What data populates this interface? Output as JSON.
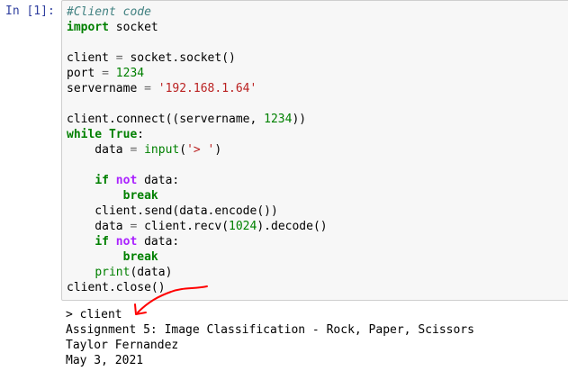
{
  "cell": {
    "prompt": "In [1]:",
    "code": [
      {
        "segments": [
          {
            "t": "#Client code",
            "c": "cm"
          }
        ]
      },
      {
        "segments": [
          {
            "t": "import",
            "c": "kw"
          },
          {
            "t": " socket",
            "c": ""
          }
        ]
      },
      {
        "segments": [
          {
            "t": "",
            "c": ""
          }
        ]
      },
      {
        "segments": [
          {
            "t": "client ",
            "c": ""
          },
          {
            "t": "=",
            "c": "op"
          },
          {
            "t": " socket.socket()",
            "c": ""
          }
        ]
      },
      {
        "segments": [
          {
            "t": "port ",
            "c": ""
          },
          {
            "t": "=",
            "c": "op"
          },
          {
            "t": " ",
            "c": ""
          },
          {
            "t": "1234",
            "c": "num"
          }
        ]
      },
      {
        "segments": [
          {
            "t": "servername ",
            "c": ""
          },
          {
            "t": "=",
            "c": "op"
          },
          {
            "t": " ",
            "c": ""
          },
          {
            "t": "'192.168.1.64'",
            "c": "str"
          }
        ]
      },
      {
        "segments": [
          {
            "t": "",
            "c": ""
          }
        ]
      },
      {
        "segments": [
          {
            "t": "client.connect((servername, ",
            "c": ""
          },
          {
            "t": "1234",
            "c": "num"
          },
          {
            "t": "))",
            "c": ""
          }
        ]
      },
      {
        "segments": [
          {
            "t": "while",
            "c": "kw"
          },
          {
            "t": " ",
            "c": ""
          },
          {
            "t": "True",
            "c": "kw"
          },
          {
            "t": ":",
            "c": ""
          }
        ]
      },
      {
        "segments": [
          {
            "t": "    data ",
            "c": ""
          },
          {
            "t": "=",
            "c": "op"
          },
          {
            "t": " ",
            "c": ""
          },
          {
            "t": "input",
            "c": "fn"
          },
          {
            "t": "(",
            "c": ""
          },
          {
            "t": "'> '",
            "c": "str"
          },
          {
            "t": ")",
            "c": ""
          }
        ]
      },
      {
        "segments": [
          {
            "t": "",
            "c": ""
          }
        ]
      },
      {
        "segments": [
          {
            "t": "    ",
            "c": ""
          },
          {
            "t": "if",
            "c": "kw"
          },
          {
            "t": " ",
            "c": ""
          },
          {
            "t": "not",
            "c": "kw-op"
          },
          {
            "t": " data:",
            "c": ""
          }
        ]
      },
      {
        "segments": [
          {
            "t": "        ",
            "c": ""
          },
          {
            "t": "break",
            "c": "kw"
          }
        ]
      },
      {
        "segments": [
          {
            "t": "    client.send(data.encode())",
            "c": ""
          }
        ]
      },
      {
        "segments": [
          {
            "t": "    data ",
            "c": ""
          },
          {
            "t": "=",
            "c": "op"
          },
          {
            "t": " client.recv(",
            "c": ""
          },
          {
            "t": "1024",
            "c": "num"
          },
          {
            "t": ").decode()",
            "c": ""
          }
        ]
      },
      {
        "segments": [
          {
            "t": "    ",
            "c": ""
          },
          {
            "t": "if",
            "c": "kw"
          },
          {
            "t": " ",
            "c": ""
          },
          {
            "t": "not",
            "c": "kw-op"
          },
          {
            "t": " data:",
            "c": ""
          }
        ]
      },
      {
        "segments": [
          {
            "t": "        ",
            "c": ""
          },
          {
            "t": "break",
            "c": "kw"
          }
        ]
      },
      {
        "segments": [
          {
            "t": "    ",
            "c": ""
          },
          {
            "t": "print",
            "c": "fn"
          },
          {
            "t": "(data)",
            "c": ""
          }
        ]
      },
      {
        "segments": [
          {
            "t": "client.close()",
            "c": ""
          }
        ]
      }
    ],
    "output": [
      "> client",
      "Assignment 5: Image Classification - Rock, Paper, Scissors",
      "Taylor Fernandez",
      "May 3, 2021"
    ]
  },
  "colors": {
    "prompt": "#303f9f",
    "cell_background": "#f7f7f7",
    "cell_border": "#cfcfcf",
    "keyword": "#008000",
    "comment": "#408080",
    "string": "#ba2121",
    "operator": "#666666",
    "annotation_arrow": "#ff0000"
  },
  "icons": {
    "annotation": "red-hand-drawn-arrow-icon"
  }
}
